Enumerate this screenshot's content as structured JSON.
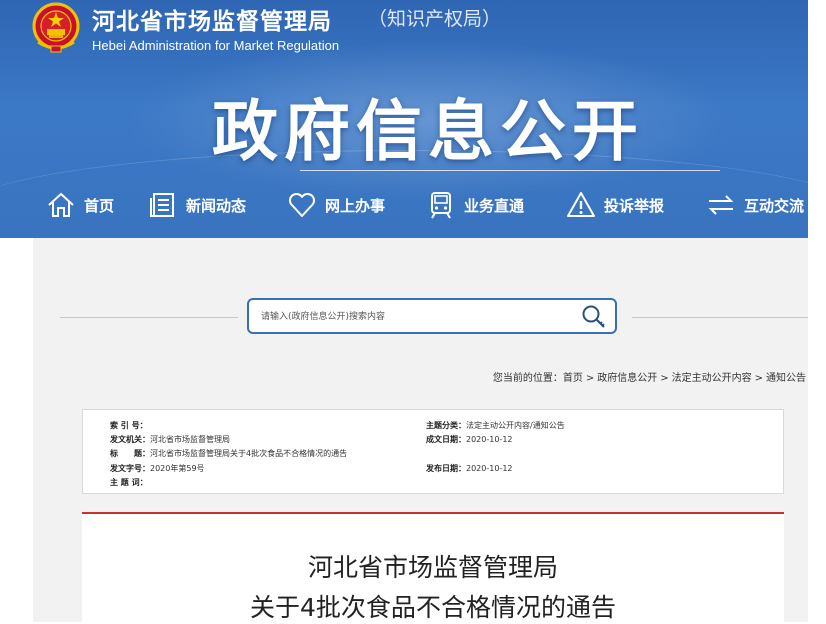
{
  "header": {
    "site_title": "河北省市场监督管理局",
    "site_subtitle": "（知识产权局）",
    "site_title_en": "Hebei Administration for Market Regulation",
    "banner_title": "政府信息公开"
  },
  "nav": [
    {
      "label": "首页",
      "icon": "home-icon"
    },
    {
      "label": "新闻动态",
      "icon": "news-icon"
    },
    {
      "label": "网上办事",
      "icon": "heart-icon"
    },
    {
      "label": "业务直通",
      "icon": "train-icon"
    },
    {
      "label": "投诉举报",
      "icon": "warning-icon"
    },
    {
      "label": "互动交流",
      "icon": "exchange-icon"
    }
  ],
  "search": {
    "placeholder": "请输入(政府信息公开)搜索内容",
    "icon": "search-icon"
  },
  "breadcrumb": {
    "prefix": "您当前的位置：",
    "items": [
      "首页",
      "政府信息公开",
      "法定主动公开内容",
      "通知公告"
    ],
    "separator": ">"
  },
  "meta": {
    "index_label": "索 引 号：",
    "index_value": "",
    "issuer_label": "发文机关：",
    "issuer_value": "河北省市场监督管理局",
    "title_label": "标　　题：",
    "title_value": "河北省市场监督管理局关于4批次食品不合格情况的通告",
    "docno_label": "发文字号：",
    "docno_value": "2020年第59号",
    "keywords_label": "主 题 词：",
    "keywords_value": "",
    "category_label": "主题分类：",
    "category_value": "法定主动公开内容/通知公告",
    "created_label": "成文日期：",
    "created_value": "2020-10-12",
    "published_label": "发布日期：",
    "published_value": "2020-10-12"
  },
  "article": {
    "title_line1": "河北省市场监督管理局",
    "title_line2": "关于4批次食品不合格情况的通告"
  },
  "colors": {
    "banner_blue": "#3b78c6",
    "search_border": "#3a6fb5",
    "article_rule": "#c9302c"
  }
}
